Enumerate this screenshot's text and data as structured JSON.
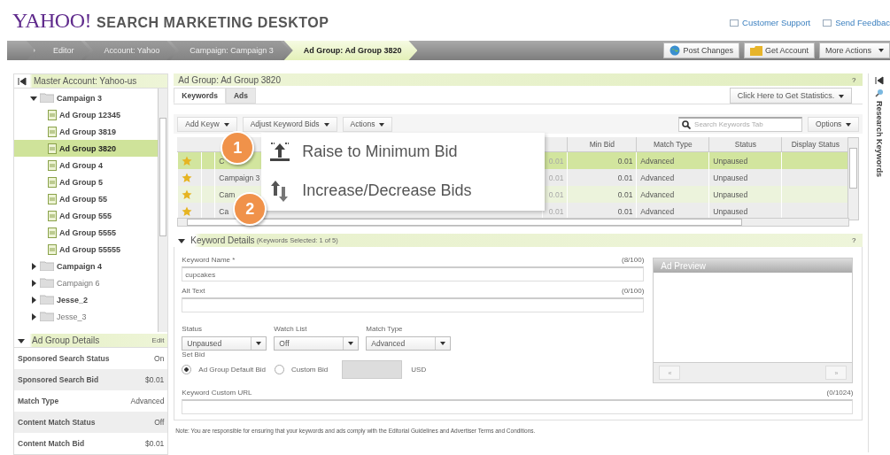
{
  "logo": {
    "brand": "YAHOO!",
    "product": "SEARCH MARKETING DESKTOP"
  },
  "header_links": [
    "Customer Support",
    "Send Feedbac"
  ],
  "breadcrumbs": [
    {
      "label": "Editor",
      "selected": false
    },
    {
      "label": "Account: Yahoo",
      "selected": false
    },
    {
      "label": "Campaign: Campaign 3",
      "selected": false
    },
    {
      "label": "Ad Group: Ad Group 3820",
      "selected": true
    }
  ],
  "top_buttons": [
    {
      "label": "Post Changes",
      "kind": "post"
    },
    {
      "label": "Get Account",
      "kind": "account"
    },
    {
      "label": "More Actions",
      "kind": "menu"
    }
  ],
  "account_panel": {
    "title": "Master Account: Yahoo-us",
    "tree": [
      {
        "label": "Campaign 3",
        "expanded": true,
        "modified": true,
        "children": [
          {
            "label": "Ad Group 12345",
            "selected": false
          },
          {
            "label": "Ad Group 3819",
            "selected": false
          },
          {
            "label": "Ad Group 3820",
            "selected": true
          },
          {
            "label": "Ad Group 4",
            "selected": false
          },
          {
            "label": "Ad Group 5",
            "selected": false
          },
          {
            "label": "Ad Group 55",
            "selected": false
          },
          {
            "label": "Ad Group 555",
            "selected": false
          },
          {
            "label": "Ad Group 5555",
            "selected": false
          },
          {
            "label": "Ad Group 55555",
            "selected": false
          }
        ]
      },
      {
        "label": "Campaign 4",
        "expanded": false,
        "modified": true
      },
      {
        "label": "Campaign 6",
        "expanded": false,
        "modified": false
      },
      {
        "label": "Jesse_2",
        "expanded": false,
        "modified": true
      },
      {
        "label": "Jesse_3",
        "expanded": false,
        "modified": false
      }
    ]
  },
  "details_panel": {
    "title": "Ad Group Details",
    "edit": "Edit",
    "rows": [
      {
        "label": "Sponsored Search Status",
        "value": "On"
      },
      {
        "label": "Sponsored Search Bid",
        "value": "$0.01"
      },
      {
        "label": "Match Type",
        "value": "Advanced"
      },
      {
        "label": "Content Match Status",
        "value": "Off"
      },
      {
        "label": "Content Match Bid",
        "value": "$0.01"
      }
    ]
  },
  "main": {
    "title": "Ad Group: Ad Group 3820",
    "help": "?",
    "tabs": [
      {
        "label": "Keywords",
        "selected": true
      },
      {
        "label": "Ads",
        "selected": false
      }
    ],
    "stats_button": "Click Here to Get Statistics.",
    "actions": [
      "Add Keyw",
      "Adjust Keyword Bids",
      "Actions"
    ],
    "search": {
      "placeholder": "Search Keywords Tab"
    },
    "options": "Options",
    "table": {
      "columns": [
        "Min Bid",
        "Match Type",
        "Status",
        "Display Status"
      ],
      "rows": [
        {
          "selected": true,
          "campaign": "C",
          "column_6": "0.01",
          "min_bid": "0.01",
          "match_type": "Advanced",
          "status": "Unpaused"
        },
        {
          "selected": false,
          "campaign": "Campaign 3",
          "column_6": "0.01",
          "min_bid": "0.01",
          "match_type": "Advanced",
          "status": "Unpaused"
        },
        {
          "selected": false,
          "campaign": "Cam",
          "column_6": "0.01",
          "min_bid": "0.01",
          "match_type": "Advanced",
          "status": "Unpaused"
        },
        {
          "selected": false,
          "campaign": "Ca",
          "column_6": "0.01",
          "min_bid": "0.01",
          "match_type": "Advanced",
          "status": "Unpaused"
        }
      ]
    },
    "menu": {
      "items": [
        {
          "label": "Raise to Minimum Bid",
          "kind": "raise"
        },
        {
          "label": "Increase/Decrease Bids",
          "kind": "adjust"
        }
      ],
      "callouts": [
        "1",
        "2"
      ]
    }
  },
  "keyword_details": {
    "title": "Keyword Details",
    "subtitle": "(Keywords Selected: 1 of 5)",
    "help": "?",
    "name_label": "Keyword Name *",
    "name_count": "(8/100)",
    "name_value": "cupcakes",
    "alt_label": "Alt Text",
    "alt_count": "(0/100)",
    "selects": [
      {
        "label": "Status",
        "value": "Unpaused"
      },
      {
        "label": "Watch List",
        "value": "Off"
      },
      {
        "label": "Match Type",
        "value": "Advanced"
      }
    ],
    "bid_label": "Set Bid",
    "bid_options": [
      {
        "label": "Ad Group Default Bid",
        "selected": true
      },
      {
        "label": "Custom Bid",
        "selected": false
      }
    ],
    "currency": "USD",
    "url_label": "Keyword Custom URL",
    "url_count": "(0/1024)",
    "preview_title": "Ad Preview",
    "preview_prev": "«",
    "preview_next": "»"
  },
  "note": "Note: You are responsible for ensuring that your keywords and ads comply with the Editorial Guidelines and Advertiser Terms and Conditions.",
  "side_panel": {
    "title": "Research Keywords"
  }
}
